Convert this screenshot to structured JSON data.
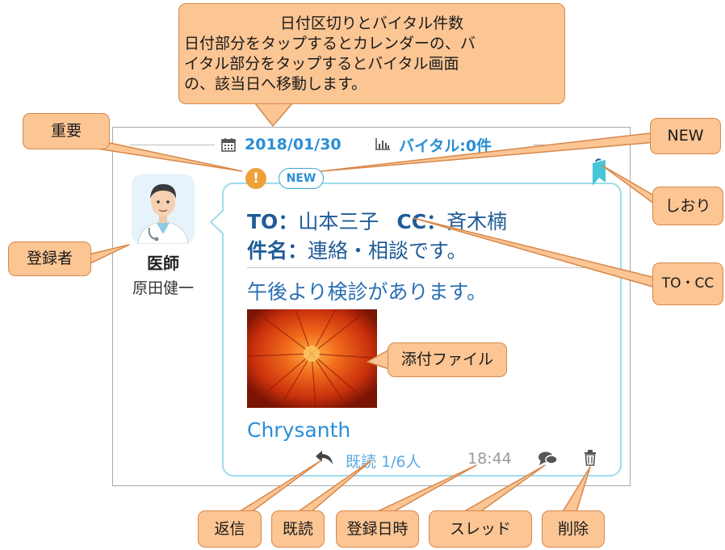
{
  "callouts": {
    "date_vital": [
      "日付区切りとバイタル件数",
      "日付部分をタップするとカレンダーの、バ",
      "イタル部分をタップするとバイタル画面",
      "の、該当日へ移動します。"
    ],
    "important": "重要",
    "new": "NEW",
    "bookmark": "しおり",
    "registrant": "登録者",
    "to_cc": "TO・CC",
    "attachment": "添付ファイル",
    "reply": "返信",
    "read": "既読",
    "registered_at": "登録日時",
    "thread": "スレッド",
    "delete": "削除"
  },
  "header": {
    "date": "2018/01/30",
    "vital": "バイタル:0件"
  },
  "author": {
    "role": "医師",
    "name": "原田健一"
  },
  "message": {
    "new_badge": "NEW",
    "important_mark": "!",
    "to_label": "TO",
    "to_value": "山本三子",
    "cc_label": "CC",
    "cc_value": "斉木楠",
    "subject_label": "件名",
    "subject_value": "連絡・相談です。",
    "sep": "：",
    "body": "午後より検診があります。",
    "attachment_name": "Chrysanth",
    "read_label": "既読",
    "read_count": "1/6人",
    "time": "18:44"
  },
  "colors": {
    "callout_fill": "#fbc594",
    "callout_border": "#d8884a",
    "accent_blue": "#2a8ed6",
    "navy": "#1f5b97",
    "bubble_border": "#9fdcec",
    "important_orange": "#f0a03a",
    "bookmark_teal": "#46c6d6"
  },
  "icons": [
    "calendar-icon",
    "chart-icon",
    "bookmark-icon",
    "reply-icon",
    "thread-icon",
    "trash-icon",
    "doctor-avatar"
  ]
}
